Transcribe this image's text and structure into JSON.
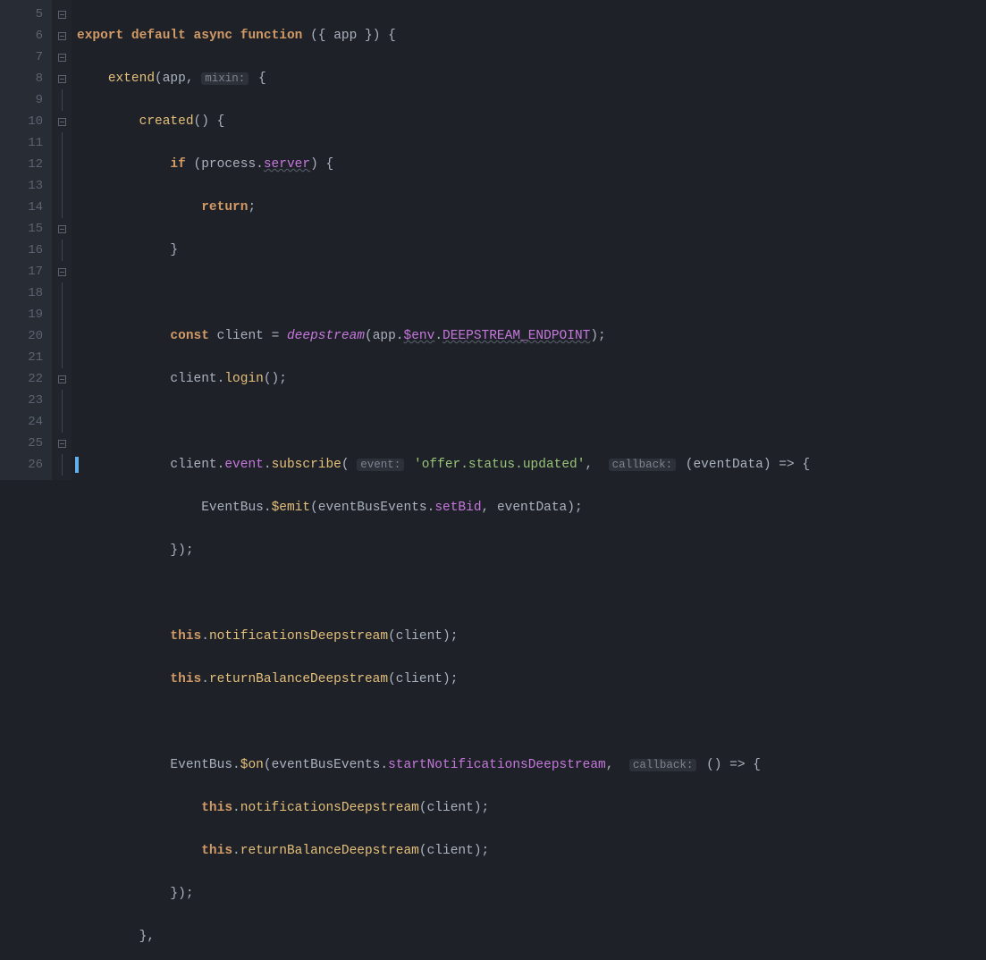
{
  "lines": {
    "start": 5,
    "end": 26
  },
  "tokens": {
    "export": "export",
    "default": "default",
    "async": "async",
    "function": "function",
    "app": "app",
    "extend": "extend",
    "mixin": "mixin:",
    "created": "created",
    "if": "if",
    "process": "process",
    "server": "server",
    "return": "return",
    "const": "const",
    "client": "client",
    "deepstream": "deepstream",
    "env": "$env",
    "endpoint": "DEEPSTREAM_ENDPOINT",
    "login": "login",
    "event": "event",
    "subscribe": "subscribe",
    "eventHint": "event:",
    "offerStr": "'offer.status.updated'",
    "callbackHint": "callback:",
    "eventData": "eventData",
    "EventBus": "EventBus",
    "emit": "$emit",
    "eventBusEvents": "eventBusEvents",
    "setBid": "setBid",
    "this": "this",
    "notificationsDeepstream": "notificationsDeepstream",
    "returnBalanceDeepstream": "returnBalanceDeepstream",
    "on": "$on",
    "startNotificationsDeepstream": "startNotificationsDeepstream"
  },
  "foldMarkers": [
    5,
    6,
    7,
    8,
    10,
    15,
    17,
    22,
    25
  ],
  "bookmarkLine": 15
}
